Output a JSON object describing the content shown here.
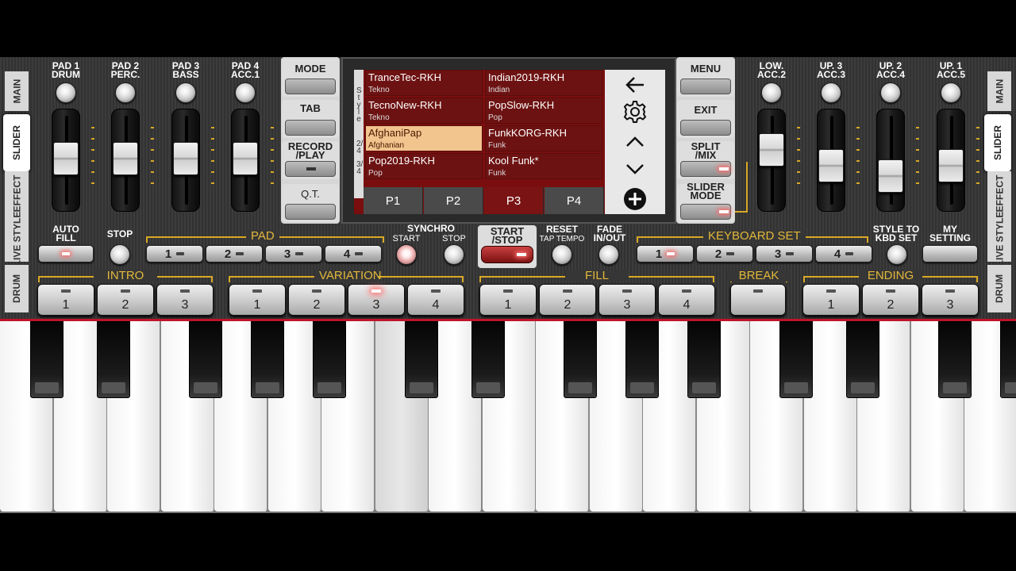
{
  "side_tabs_left": [
    "MAIN",
    "SLIDER",
    "EFFECT",
    "LIVE STYLE",
    "DRUM"
  ],
  "side_tabs_right": [
    "MAIN",
    "SLIDER",
    "EFFECT",
    "LIVE STYLE",
    "DRUM"
  ],
  "left_sliders": [
    {
      "label1": "PAD 1",
      "label2": "DRUM",
      "level": 0.62
    },
    {
      "label1": "PAD 2",
      "label2": "PERC.",
      "level": 0.62
    },
    {
      "label1": "PAD 3",
      "label2": "BASS",
      "level": 0.62
    },
    {
      "label1": "PAD 4",
      "label2": "ACC.1",
      "level": 0.62
    }
  ],
  "right_sliders": [
    {
      "label1": "LOW.",
      "label2": "ACC.2",
      "level": 0.75
    },
    {
      "label1": "UP. 3",
      "label2": "ACC.3",
      "level": 0.52
    },
    {
      "label1": "UP. 2",
      "label2": "ACC.4",
      "level": 0.38
    },
    {
      "label1": "UP. 1",
      "label2": "ACC.5",
      "level": 0.52
    }
  ],
  "left_menu": [
    {
      "label": "MODE"
    },
    {
      "label": "TAB"
    },
    {
      "label": "RECORD /PLAY"
    },
    {
      "label": "Q.T."
    }
  ],
  "right_menu": [
    {
      "label": "MENU"
    },
    {
      "label": "EXIT"
    },
    {
      "label": "SPLIT /MIX"
    },
    {
      "label": "SLIDER MODE"
    }
  ],
  "style_browser": {
    "side_label": "Style",
    "meters": [
      "2/4",
      "3/4"
    ],
    "styles": [
      {
        "name": "TranceTec-RKH",
        "category": "Tekno"
      },
      {
        "name": "Indian2019-RKH",
        "category": "Indian"
      },
      {
        "name": "TecnoNew-RKH",
        "category": "Tekno"
      },
      {
        "name": "PopSlow-RKH",
        "category": "Pop"
      },
      {
        "name": "AfghaniPap",
        "category": "Afghanian",
        "selected": true
      },
      {
        "name": "FunkKORG-RKH",
        "category": "Funk"
      },
      {
        "name": "Pop2019-RKH",
        "category": "Pop"
      },
      {
        "name": "Kool Funk*",
        "category": "Funk"
      }
    ],
    "pages": [
      "P1",
      "P2",
      "P3",
      "P4"
    ],
    "active_page": "P3",
    "nav_icons": [
      "back-arrow-icon",
      "gear-icon",
      "chevron-up-icon",
      "chevron-down-icon",
      "plus-circle-icon"
    ]
  },
  "controls": {
    "auto_fill": "AUTO FILL",
    "stop": "STOP",
    "pad_group": "PAD",
    "pads": [
      "1",
      "2",
      "3",
      "4"
    ],
    "synchro": "SYNCHRO",
    "synchro_start": "START",
    "synchro_stop": "STOP",
    "start_stop": "START /STOP",
    "reset": "RESET",
    "tap_tempo": "TAP TEMPO",
    "fade": "FADE IN/OUT",
    "keyboard_set_group": "KEYBOARD SET",
    "keyboard_sets": [
      "1",
      "2",
      "3",
      "4"
    ],
    "style_to_kbd": "STYLE TO KBD SET",
    "my_setting": "MY SETTING"
  },
  "sections": {
    "intro": {
      "label": "INTRO",
      "buttons": [
        "1",
        "2",
        "3"
      ]
    },
    "variation": {
      "label": "VARIATION",
      "buttons": [
        "1",
        "2",
        "3",
        "4"
      ],
      "active": "3"
    },
    "fill": {
      "label": "FILL",
      "buttons": [
        "1",
        "2",
        "3",
        "4"
      ]
    },
    "break": {
      "label": "BREAK"
    },
    "ending": {
      "label": "ENDING",
      "buttons": [
        "1",
        "2",
        "3"
      ]
    }
  },
  "keyboard": {
    "white_keys": 19,
    "pressed_white_key": 7
  },
  "colors": {
    "accent_gold": "#d9a826",
    "style_cell": "#6d1212",
    "style_selected": "#f2c48e",
    "red_line": "#c0142a"
  }
}
